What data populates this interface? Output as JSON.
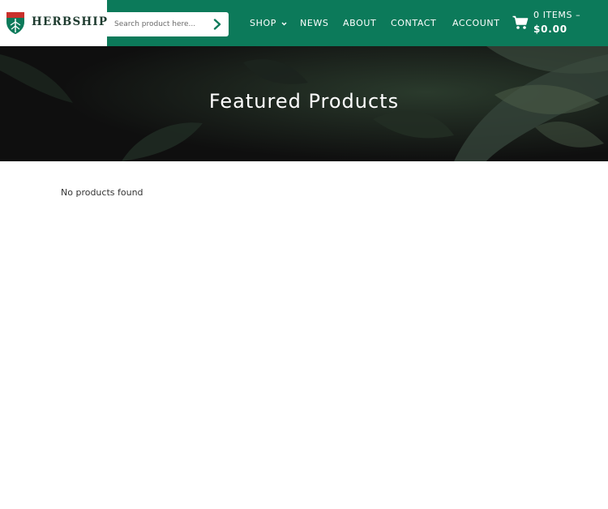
{
  "brand": {
    "name": "HERBSHIP",
    "logo_icon": "shield-icon",
    "colors": {
      "header_bg": "#0c7a5a",
      "shield_red": "#c9302c",
      "shield_green": "#0c7a5a",
      "hero_bg": "#141414"
    }
  },
  "search": {
    "placeholder": "Search product here...",
    "value": "",
    "submit_icon": "chevron-right-icon"
  },
  "nav": {
    "items": [
      {
        "label": "SHOP",
        "has_dropdown": true
      },
      {
        "label": "NEWS"
      },
      {
        "label": "ABOUT"
      },
      {
        "label": "CONTACT"
      },
      {
        "label": "ACCOUNT"
      }
    ]
  },
  "cart": {
    "icon": "cart-icon",
    "items_label": "0 ITEMS –",
    "total": "$0.00"
  },
  "hero": {
    "title": "Featured Products"
  },
  "main": {
    "empty_message": "No products found"
  }
}
